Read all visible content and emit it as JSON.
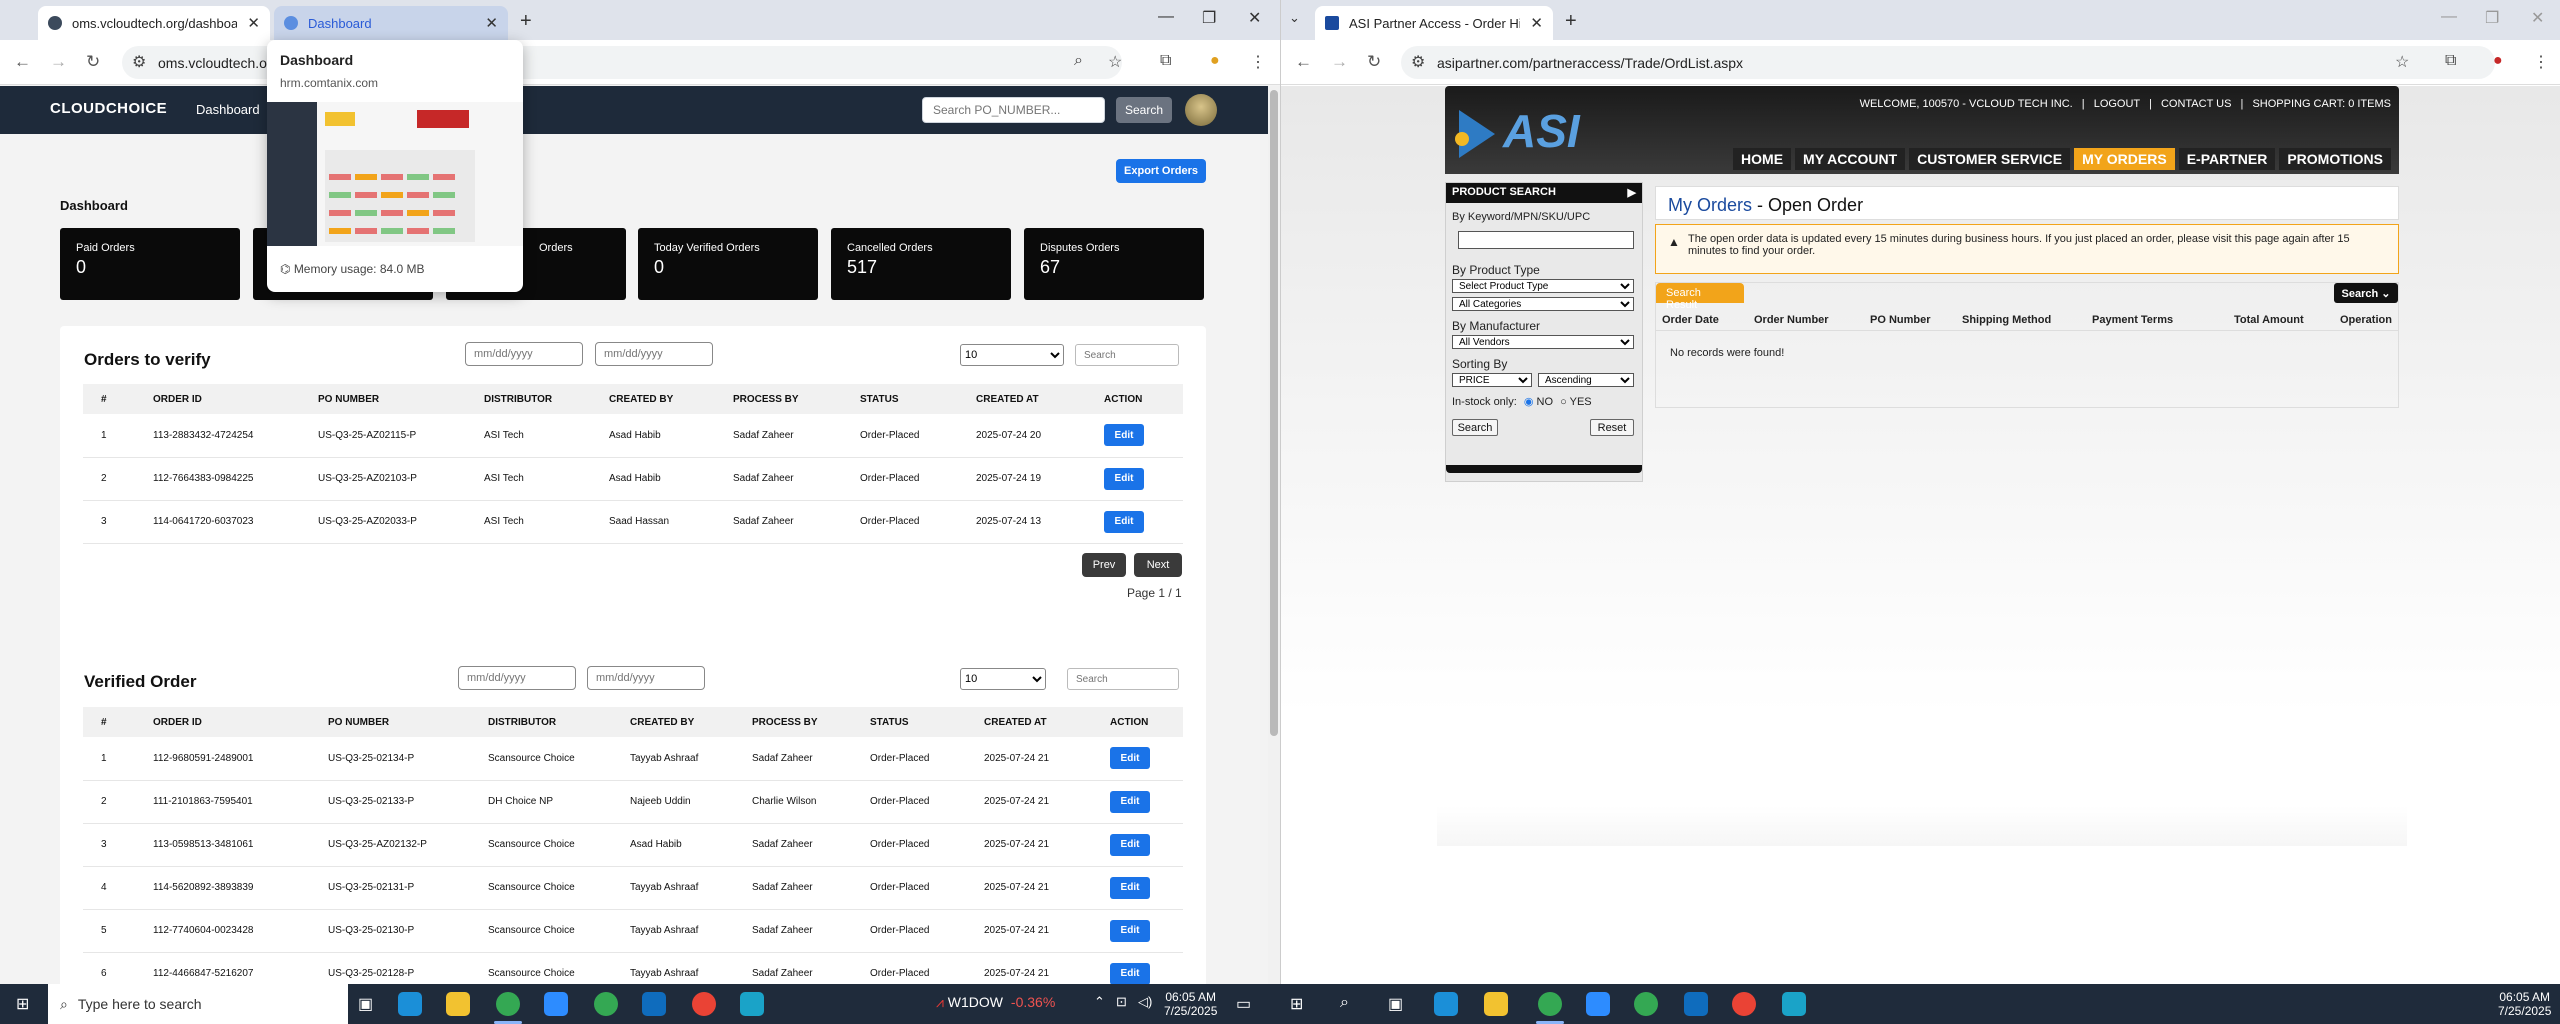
{
  "left_browser": {
    "tabs": [
      {
        "title": "oms.vcloudtech.org/dashboard",
        "state": "active"
      },
      {
        "title": "Dashboard",
        "state": "hover"
      }
    ],
    "address": "oms.vcloudtech.o",
    "tab_preview": {
      "title": "Dashboard",
      "url": "hrm.comtanix.com",
      "memory": "Memory usage: 84.0 MB"
    },
    "app": {
      "logo": "CLOUDCHOICE",
      "nav_label": "Dashboard",
      "search_placeholder": "Search PO_NUMBER...",
      "search_button": "Search",
      "export_button": "Export Orders",
      "page_title": "Dashboard",
      "cards": [
        {
          "label": "Paid Orders",
          "value": "0"
        },
        {
          "label": "",
          "value": ""
        },
        {
          "label": "Orders",
          "value": ""
        },
        {
          "label": "Today Verified Orders",
          "value": "0"
        },
        {
          "label": "Cancelled Orders",
          "value": "517"
        },
        {
          "label": "Disputes Orders",
          "value": "67"
        }
      ],
      "verify_panel": {
        "title": "Orders to verify",
        "date_placeholder": "mm/dd/yyyy",
        "page_size": "10",
        "search_placeholder": "Search",
        "headers": [
          "#",
          "ORDER ID",
          "PO NUMBER",
          "DISTRIBUTOR",
          "CREATED BY",
          "PROCESS BY",
          "STATUS",
          "CREATED AT",
          "ACTION"
        ],
        "rows": [
          [
            "1",
            "113-2883432-4724254",
            "US-Q3-25-AZ02115-P",
            "ASI Tech",
            "Asad Habib",
            "Sadaf Zaheer",
            "Order-Placed",
            "2025-07-24 20"
          ],
          [
            "2",
            "112-7664383-0984225",
            "US-Q3-25-AZ02103-P",
            "ASI Tech",
            "Asad Habib",
            "Sadaf Zaheer",
            "Order-Placed",
            "2025-07-24 19"
          ],
          [
            "3",
            "114-0641720-6037023",
            "US-Q3-25-AZ02033-P",
            "ASI Tech",
            "Saad Hassan",
            "Sadaf Zaheer",
            "Order-Placed",
            "2025-07-24 13"
          ]
        ],
        "edit_label": "Edit",
        "prev_label": "Prev",
        "next_label": "Next",
        "page_info": "Page 1 / 1"
      },
      "verified_panel": {
        "title": "Verified Order",
        "date_placeholder": "mm/dd/yyyy",
        "page_size": "10",
        "search_placeholder": "Search",
        "headers": [
          "#",
          "ORDER ID",
          "PO NUMBER",
          "DISTRIBUTOR",
          "CREATED BY",
          "PROCESS BY",
          "STATUS",
          "CREATED AT",
          "ACTION"
        ],
        "rows": [
          [
            "1",
            "112-9680591-2489001",
            "US-Q3-25-02134-P",
            "Scansource Choice",
            "Tayyab Ashraaf",
            "Sadaf Zaheer",
            "Order-Placed",
            "2025-07-24 21"
          ],
          [
            "2",
            "111-2101863-7595401",
            "US-Q3-25-02133-P",
            "DH Choice NP",
            "Najeeb Uddin",
            "Charlie Wilson",
            "Order-Placed",
            "2025-07-24 21"
          ],
          [
            "3",
            "113-0598513-3481061",
            "US-Q3-25-AZ02132-P",
            "Scansource Choice",
            "Asad Habib",
            "Sadaf Zaheer",
            "Order-Placed",
            "2025-07-24 21"
          ],
          [
            "4",
            "114-5620892-3893839",
            "US-Q3-25-02131-P",
            "Scansource Choice",
            "Tayyab Ashraaf",
            "Sadaf Zaheer",
            "Order-Placed",
            "2025-07-24 21"
          ],
          [
            "5",
            "112-7740604-0023428",
            "US-Q3-25-02130-P",
            "Scansource Choice",
            "Tayyab Ashraaf",
            "Sadaf Zaheer",
            "Order-Placed",
            "2025-07-24 21"
          ],
          [
            "6",
            "112-4466847-5216207",
            "US-Q3-25-02128-P",
            "Scansource Choice",
            "Tayyab Ashraaf",
            "Sadaf Zaheer",
            "Order-Placed",
            "2025-07-24 21"
          ]
        ],
        "edit_label": "Edit"
      }
    }
  },
  "right_browser": {
    "tab_title": "ASI Partner Access - Order Histo",
    "address": "asipartner.com/partneraccess/Trade/OrdList.aspx",
    "asi": {
      "logo": "ASI",
      "welcome": "WELCOME, 100570 - VCLOUD TECH INC.",
      "logout": "LOGOUT",
      "contact": "CONTACT US",
      "cart": "SHOPPING CART: 0 ITEMS",
      "nav": [
        "HOME",
        "MY ACCOUNT",
        "CUSTOMER SERVICE",
        "MY ORDERS",
        "E-PARTNER",
        "PROMOTIONS"
      ],
      "side": {
        "title": "PRODUCT SEARCH",
        "keyword_label": "By Keyword/MPN/SKU/UPC",
        "type_label": "By Product Type",
        "type_select": "Select Product Type",
        "category_select": "All Categories",
        "manufacturer_label": "By Manufacturer",
        "vendor_select": "All Vendors",
        "sorting_label": "Sorting By",
        "sort_field": "PRICE",
        "sort_order": "Ascending",
        "instock_label": "In-stock only:",
        "no_label": "NO",
        "yes_label": "YES",
        "search_button": "Search",
        "reset_button": "Reset"
      },
      "main": {
        "title_a": "My Orders",
        "title_b": " - Open Order",
        "notice": "The open order data is updated every 15 minutes during business hours. If you just placed an order, please visit this page again after 15 minutes to find your order.",
        "result_tab": "Search Result",
        "search_button": "Search",
        "headers": [
          "Order Date",
          "Order Number",
          "PO Number",
          "Shipping Method",
          "Payment Terms",
          "Total Amount",
          "Operation"
        ],
        "empty": "No records were found!"
      }
    }
  },
  "taskbar": {
    "search_placeholder": "Type here to search",
    "stock": "W1DOW",
    "stock_change": "-0.36%",
    "time_left": "06:05 AM",
    "date_left": "7/25/2025",
    "time_right": "06:05 AM",
    "date_right": "7/25/2025"
  }
}
